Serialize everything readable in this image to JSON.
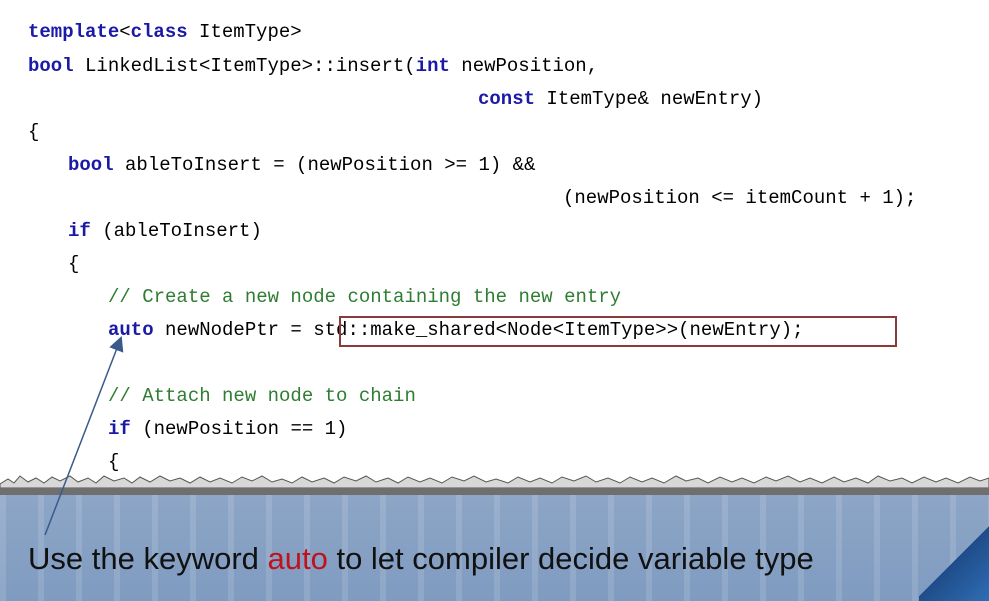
{
  "code": {
    "line1": {
      "kw": "template",
      "t1": "<",
      "kw2": "class",
      "t2": " ItemType>"
    },
    "line2": {
      "kw": "bool",
      "t1": " LinkedList<ItemType>::insert(",
      "kw2": "int",
      "t2": " newPosition,"
    },
    "line3": {
      "kw": "const",
      "t1": " ItemType& newEntry)"
    },
    "line4": {
      "t1": "{"
    },
    "line5": {
      "kw": "bool",
      "t1": " ableToInsert = (newPosition >= 1) &&"
    },
    "line6": {
      "t1": "(newPosition <= itemCount + 1);"
    },
    "line7": {
      "kw": "if",
      "t1": " (ableToInsert)"
    },
    "line8": {
      "t1": "{"
    },
    "line9": {
      "comment": "// Create a new node containing the new entry"
    },
    "line10": {
      "kw": "auto",
      "t1": " newNodePtr = ",
      "t2": "std::make_shared<Node<ItemType>>(newEntry)",
      "t3": ";"
    },
    "line11": {
      "comment": "// Attach new node to chain"
    },
    "line12": {
      "kw": "if",
      "t1": " (newPosition == 1)"
    },
    "line13": {
      "t1": "{"
    }
  },
  "caption": {
    "before": "Use the keyword ",
    "keyword": "auto",
    "after": " to let compiler decide variable type"
  },
  "colors": {
    "keyword": "#1a1aa6",
    "comment": "#2e7d32",
    "highlight_border": "#8b3a3a",
    "caption_keyword": "#c0121b"
  }
}
